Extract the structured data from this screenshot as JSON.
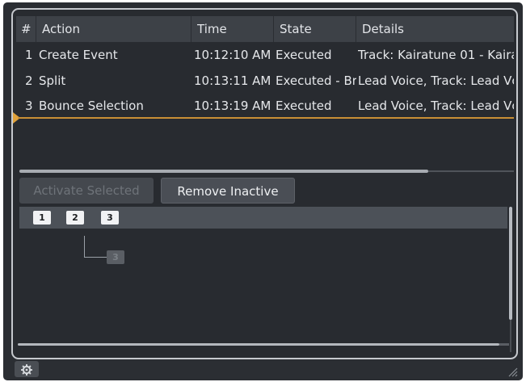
{
  "table": {
    "columns": [
      "#",
      "Action",
      "Time",
      "State",
      "Details"
    ],
    "rows": [
      {
        "num": "1",
        "action": "Create Event",
        "time": "10:12:10 AM",
        "state": "Executed",
        "details": "Track: Kairatune 01 - Kaira"
      },
      {
        "num": "2",
        "action": "Split",
        "time": "10:13:11 AM",
        "state": "Executed - Br",
        "details": "Lead Voice, Track: Lead Vc"
      },
      {
        "num": "3",
        "action": "Bounce Selection",
        "time": "10:13:19 AM",
        "state": "Executed",
        "details": "Lead Voice, Track: Lead Vc"
      }
    ]
  },
  "buttons": {
    "activate_selected": "Activate Selected",
    "remove_inactive": "Remove Inactive"
  },
  "tree": {
    "nodes": [
      "1",
      "2",
      "3"
    ],
    "inactive_node": "3"
  },
  "icons": {
    "settings": "gear-icon",
    "current_position": "triangle-marker-icon",
    "resize": "resize-grip-icon"
  },
  "colors": {
    "accent_marker": "#e0a23c",
    "panel_bg": "#282b30"
  }
}
